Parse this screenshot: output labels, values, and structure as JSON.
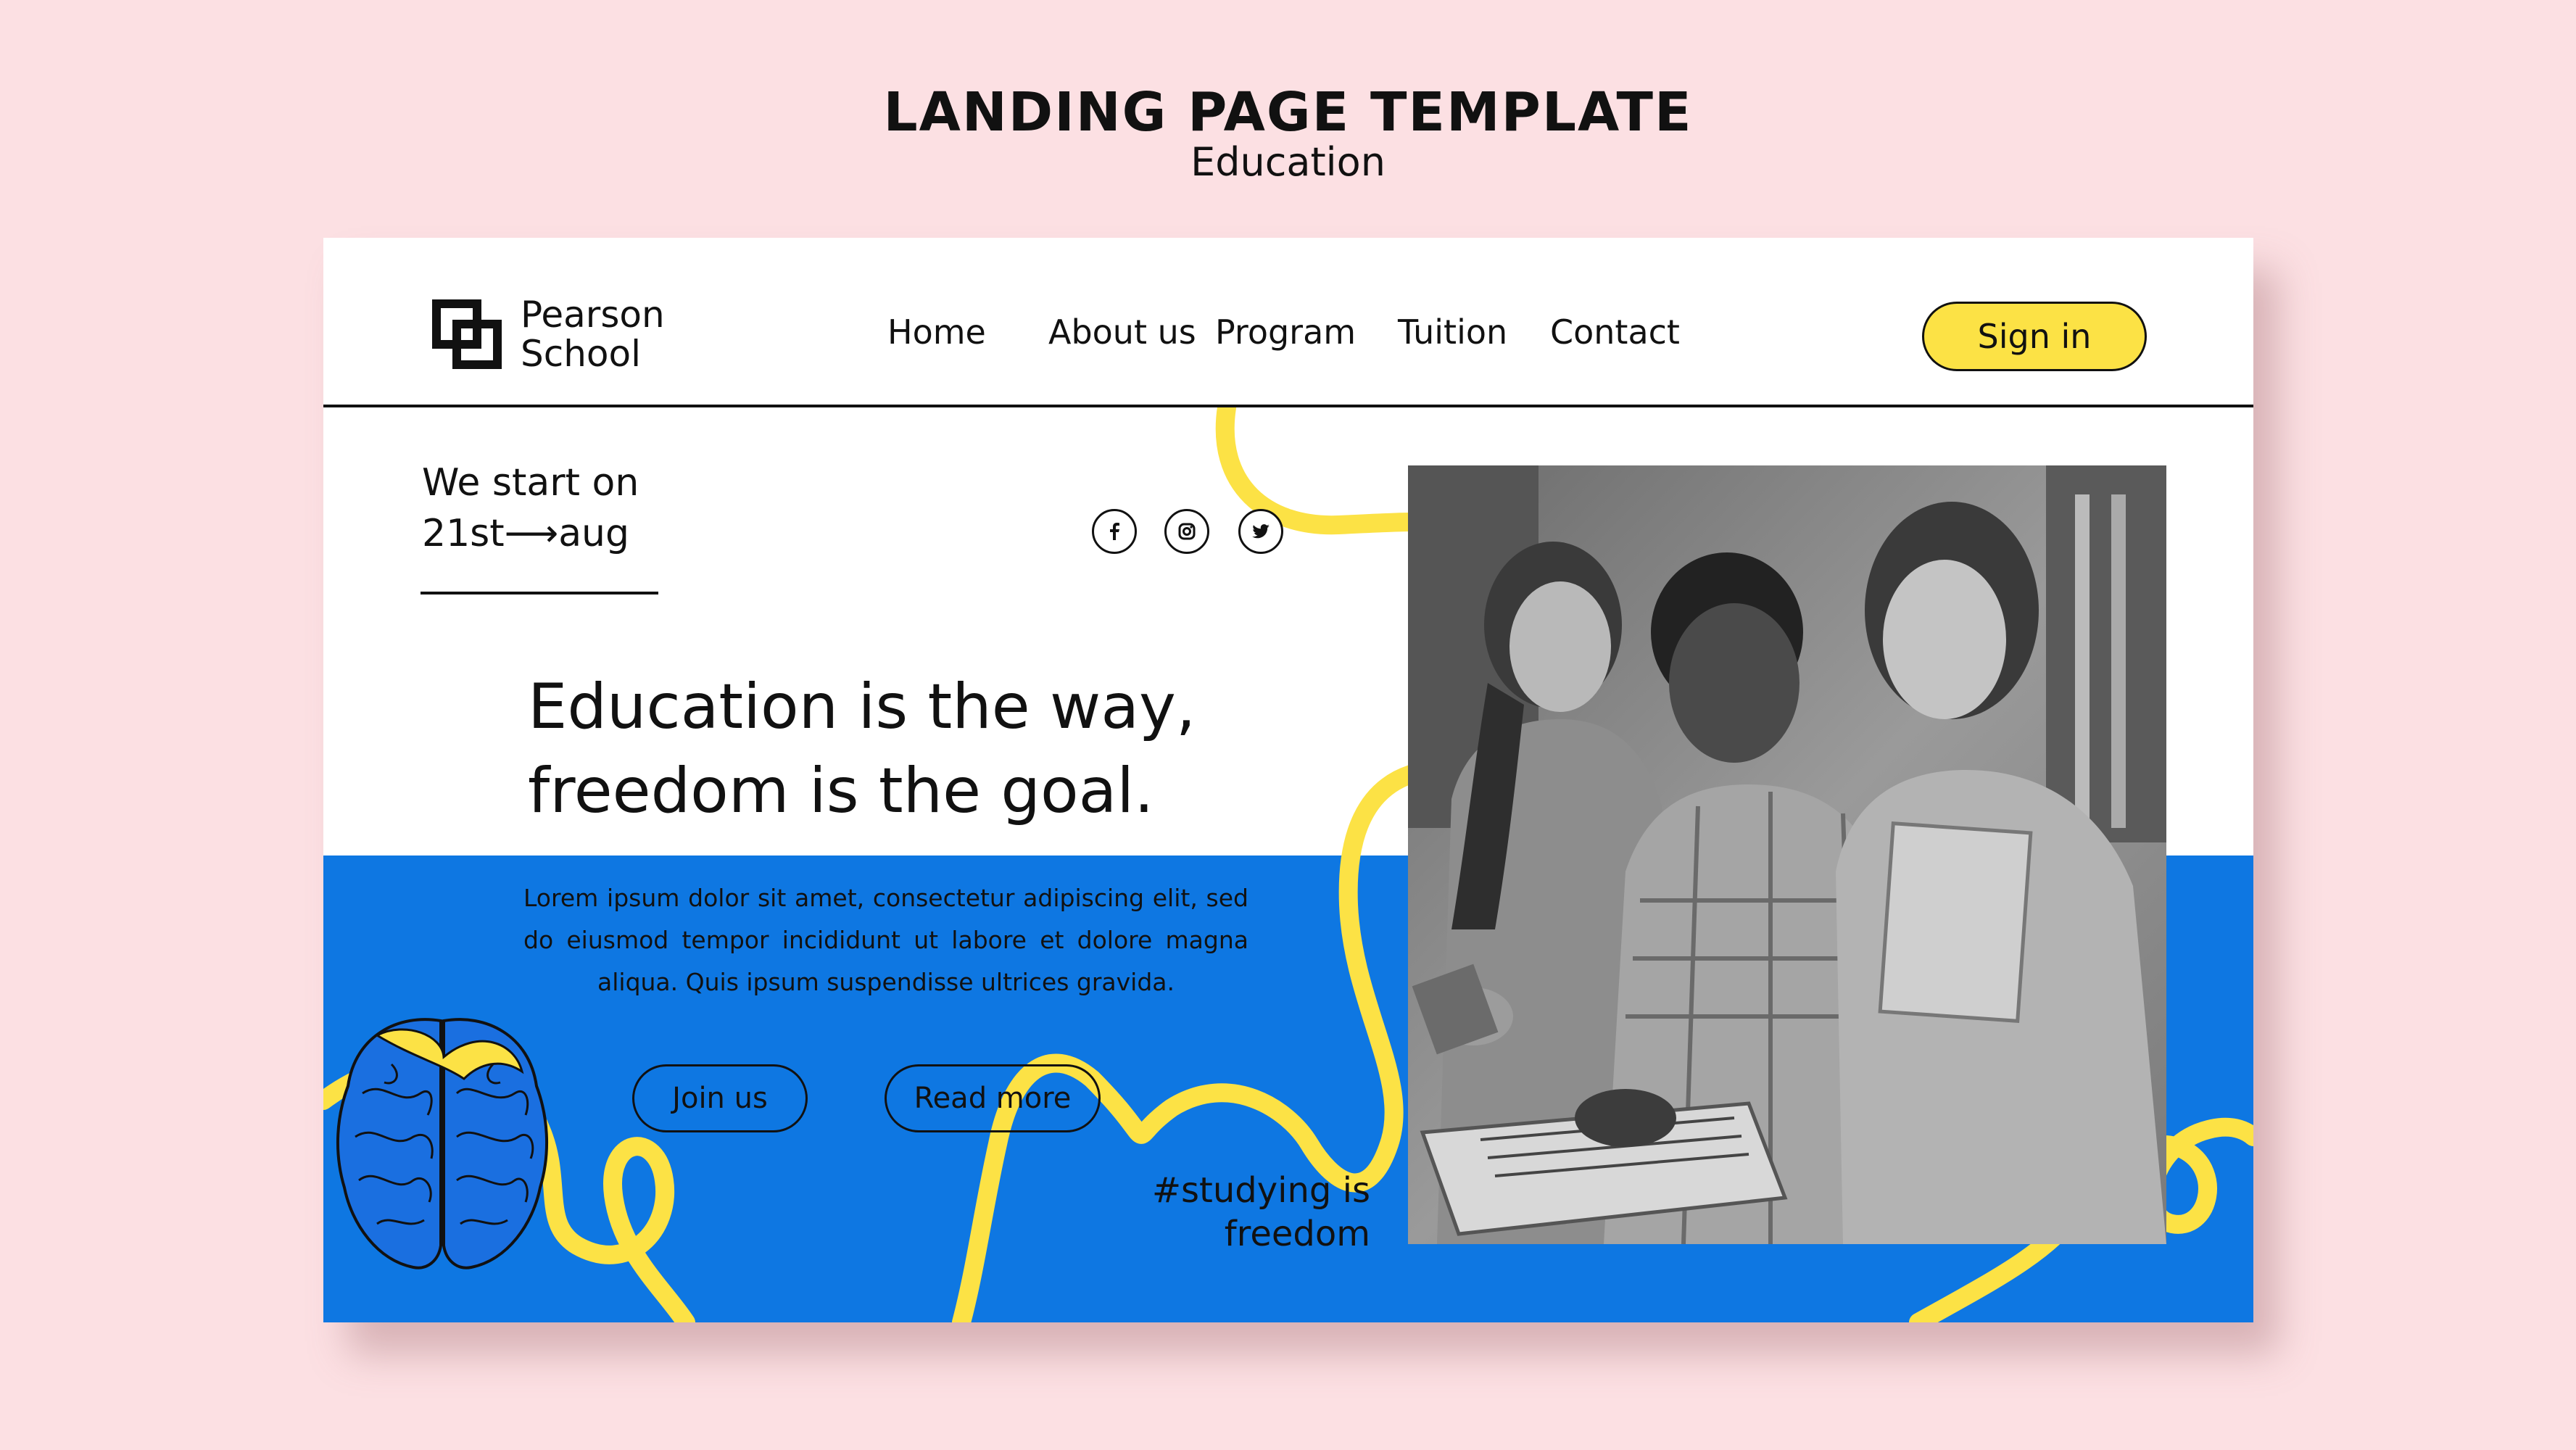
{
  "header": {
    "title": "LANDING PAGE TEMPLATE",
    "subtitle": "Education"
  },
  "logo": {
    "line1": "Pearson",
    "line2": "School",
    "icon": "overlapping-squares-logo-icon"
  },
  "nav": {
    "items": [
      "Home",
      "About us",
      "Program",
      "Tuition",
      "Contact"
    ],
    "signin_label": "Sign in"
  },
  "hero": {
    "start_line1": "We start on",
    "start_line2": "21st⟶aug",
    "headline_line1": "Education is the way,",
    "headline_line2": "freedom is the goal.",
    "body": "Lorem ipsum dolor sit amet, consectetur adipiscing elit, sed do eiusmod tempor incididunt ut labore et dolore magna aliqua. Quis ipsum suspendisse ultrices gravida.",
    "join_label": "Join us",
    "readmore_label": "Read more",
    "hashtag_line1": "#studying is",
    "hashtag_line2": "freedom"
  },
  "social": {
    "icons": [
      "facebook-icon",
      "instagram-icon",
      "twitter-icon"
    ]
  },
  "photo": {
    "description_icon": "students-with-laptop-photo"
  },
  "colors": {
    "background": "#fce0e3",
    "accent_yellow": "#fce245",
    "accent_blue": "#0e77e2",
    "text": "#111111"
  }
}
